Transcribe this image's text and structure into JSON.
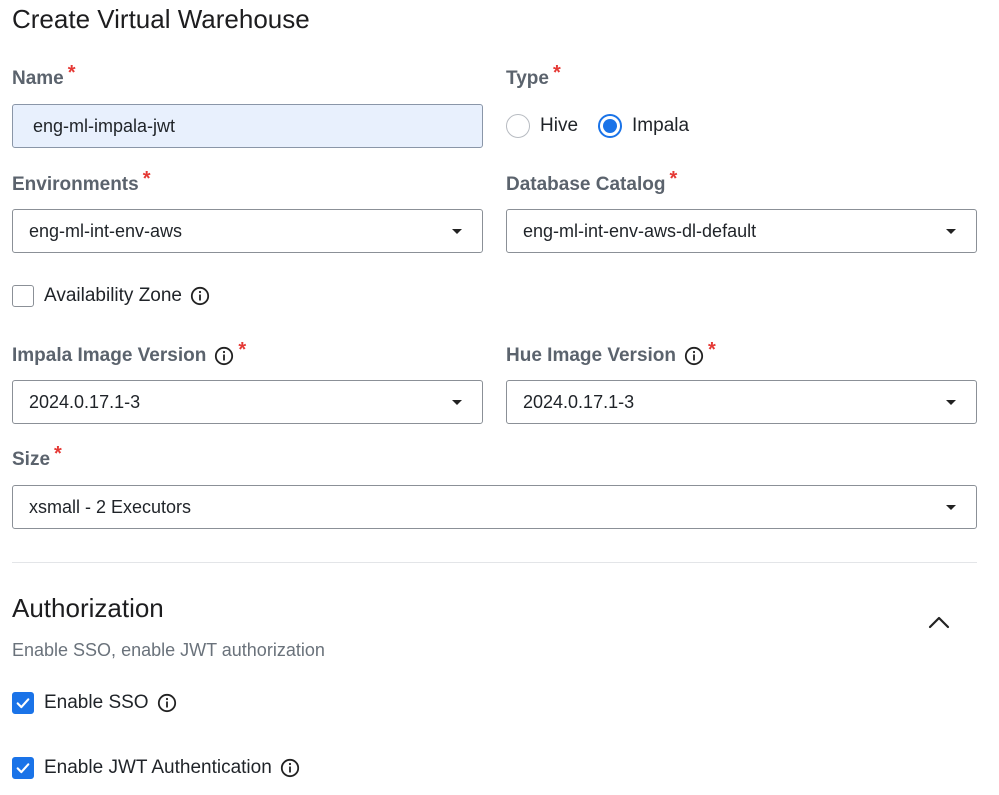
{
  "page": {
    "title": "Create Virtual Warehouse"
  },
  "form": {
    "name": {
      "label": "Name",
      "required_mark": "*",
      "value": "eng-ml-impala-jwt"
    },
    "type": {
      "label": "Type",
      "required_mark": "*",
      "options": [
        {
          "label": "Hive",
          "selected": false
        },
        {
          "label": "Impala",
          "selected": true
        }
      ]
    },
    "environments": {
      "label": "Environments",
      "required_mark": "*",
      "value": "eng-ml-int-env-aws"
    },
    "database_catalog": {
      "label": "Database Catalog",
      "required_mark": "*",
      "value": "eng-ml-int-env-aws-dl-default"
    },
    "availability_zone": {
      "label": "Availability Zone",
      "checked": false
    },
    "impala_image_version": {
      "label": "Impala Image Version",
      "required_mark": "*",
      "value": "2024.0.17.1-3"
    },
    "hue_image_version": {
      "label": "Hue Image Version",
      "required_mark": "*",
      "value": "2024.0.17.1-3"
    },
    "size": {
      "label": "Size",
      "required_mark": "*",
      "value": "xsmall - 2 Executors"
    }
  },
  "authorization": {
    "title": "Authorization",
    "subtitle": "Enable SSO, enable JWT authorization",
    "enable_sso": {
      "label": "Enable SSO",
      "checked": true
    },
    "enable_jwt": {
      "label": "Enable JWT Authentication",
      "checked": true
    }
  },
  "icons": {
    "info": "info-icon",
    "caret": "caret-down-icon",
    "collapse": "chevron-up-icon",
    "check": "checkmark-icon"
  },
  "colors": {
    "accent": "#1a73e8",
    "required": "#e53935",
    "filled_input_bg": "#e8f0fd",
    "label": "#5b636d"
  }
}
